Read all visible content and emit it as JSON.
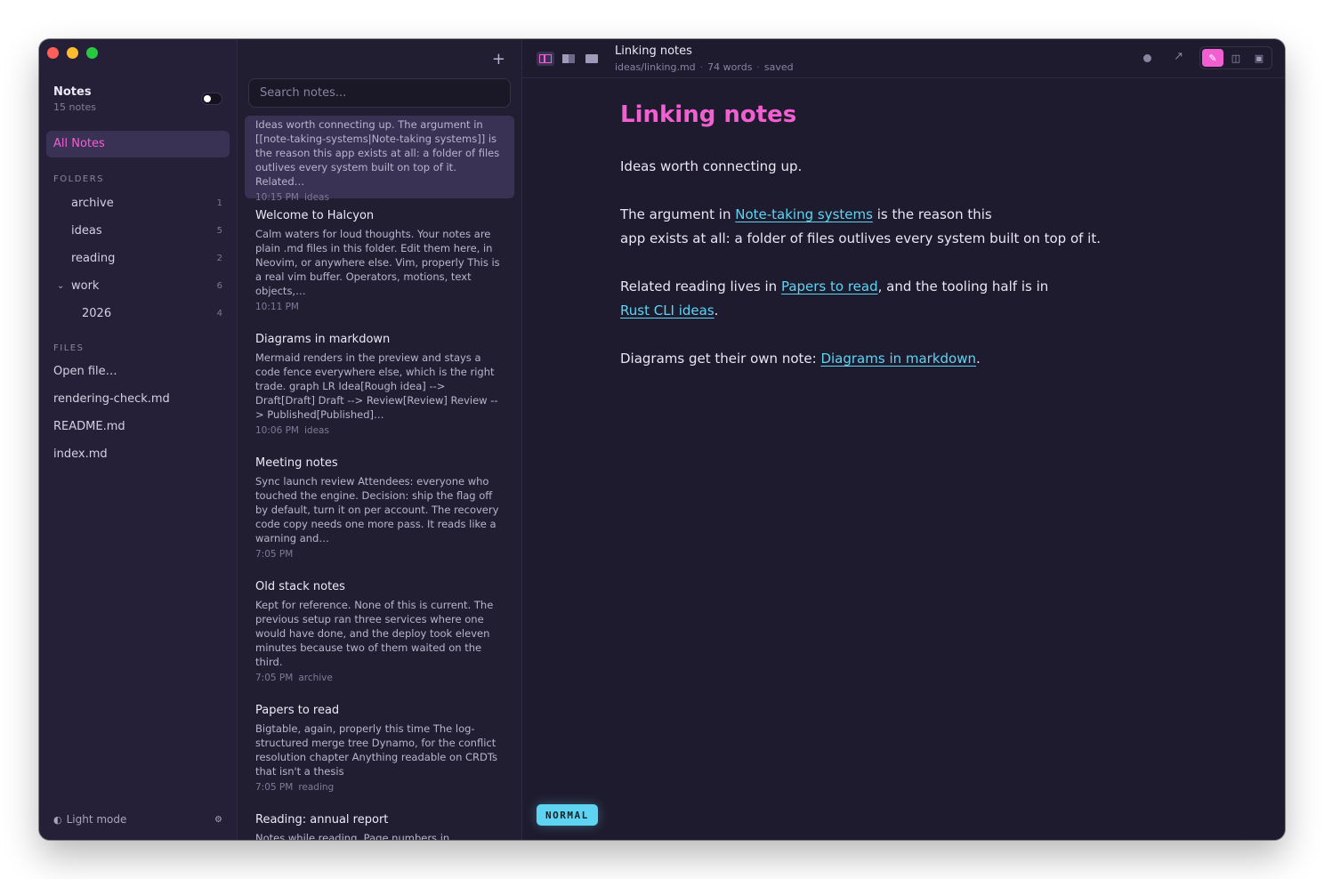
{
  "colors": {
    "accent": "#f25fd0",
    "link": "#5fd4f2",
    "bg": "#1f1b2e"
  },
  "sidebar": {
    "title": "Notes",
    "count": "15 notes",
    "all_notes": "All Notes",
    "folders_label": "FOLDERS",
    "folders": [
      {
        "name": "archive",
        "count": "1"
      },
      {
        "name": "ideas",
        "count": "5"
      },
      {
        "name": "reading",
        "count": "2"
      },
      {
        "name": "work",
        "count": "6"
      },
      {
        "name": "2026",
        "count": "4"
      }
    ],
    "files_label": "FILES",
    "files": [
      "Open file…",
      "rendering-check.md",
      "README.md",
      "index.md"
    ],
    "footer": "Light mode"
  },
  "list": {
    "search_placeholder": "Search notes...",
    "notes": [
      {
        "title": "",
        "body": "Ideas worth connecting up. The argument in [[note-taking-systems|Note-taking systems]] is the reason this app exists at all: a folder of files outlives every system built on top of it. Related…",
        "time": "10:15 PM",
        "tag": "ideas"
      },
      {
        "title": "Welcome to Halcyon",
        "body": "Calm waters for loud thoughts. Your notes are plain .md files in this folder. Edit them here, in Neovim, or anywhere else. Vim, properly This is a real vim buffer. Operators, motions, text objects,…",
        "time": "10:11 PM",
        "tag": ""
      },
      {
        "title": "Diagrams in markdown",
        "body": "Mermaid renders in the preview and stays a code fence everywhere else, which is the right trade. graph LR Idea[Rough idea] --> Draft[Draft] Draft --> Review[Review] Review --> Published[Published]…",
        "time": "10:06 PM",
        "tag": "ideas"
      },
      {
        "title": "Meeting notes",
        "body": "Sync launch review Attendees: everyone who touched the engine. Decision: ship the flag off by default, turn it on per account. The recovery code copy needs one more pass. It reads like a warning and…",
        "time": "7:05 PM",
        "tag": ""
      },
      {
        "title": "Old stack notes",
        "body": "Kept for reference. None of this is current. The previous setup ran three services where one would have done, and the deploy took eleven minutes because two of them waited on the third.",
        "time": "7:05 PM",
        "tag": "archive"
      },
      {
        "title": "Papers to read",
        "body": "Bigtable, again, properly this time The log-structured merge tree Dynamo, for the conflict resolution chapter Anything readable on CRDTs that isn't a thesis",
        "time": "7:05 PM",
        "tag": "reading"
      },
      {
        "title": "Reading: annual report",
        "body": "Notes while reading. Page numbers in brackets…",
        "time": "",
        "tag": ""
      }
    ]
  },
  "editor": {
    "title": "Linking notes",
    "path": "ideas/linking.md",
    "words": "74 words",
    "status": "saved",
    "heading": "Linking notes",
    "p1": "Ideas worth connecting up.",
    "p2a": "The argument in ",
    "p2link": "Note-taking systems",
    "p2b": " is the reason this",
    "p2c": "app exists at all: a folder of files outlives every system built on top of it.",
    "p3a": "Related reading lives in ",
    "p3link1": "Papers to read",
    "p3b": ", and the tooling half is in",
    "p3link2": "Rust CLI ideas",
    "p3c": ".",
    "p4a": "Diagrams get their own note: ",
    "p4link": "Diagrams in markdown",
    "p4b": ".",
    "mode": "NORMAL"
  }
}
